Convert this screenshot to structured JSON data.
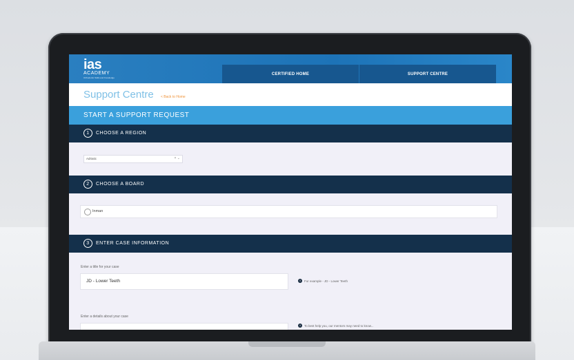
{
  "header": {
    "logo_mark": "ias",
    "logo_sub": "ACADEMY",
    "logo_tag": "Orthodontic Skills and Knowledge"
  },
  "nav": {
    "items": [
      "CERTIFIED HOME",
      "SUPPORT CENTRE"
    ]
  },
  "page": {
    "title": "Support Centre",
    "back_link": "< Back to Home"
  },
  "start_bar": {
    "label": "START A SUPPORT REQUEST"
  },
  "sections": [
    {
      "number": "1",
      "label": "CHOOSE A REGION"
    },
    {
      "number": "2",
      "label": "CHOOSE A BOARD"
    },
    {
      "number": "3",
      "label": "ENTER CASE INFORMATION"
    }
  ],
  "region": {
    "selected": "Adriatic",
    "clear": "×",
    "chevron": "⌄"
  },
  "board": {
    "option_label": "Inman"
  },
  "case": {
    "title_label": "Enter a title for your case",
    "title_value": "JD - Lower Teeth",
    "title_hint": "For example - JD - Lower Teeth",
    "details_label": "Enter a details about your case",
    "details_hint": "To best help you, our mentors may need to know..."
  },
  "icons": {
    "info": "info-icon",
    "radio": "radio-icon"
  },
  "colors": {
    "topbar": "#1d73b7",
    "nav": "#17578f",
    "start_bar": "#3aa0dc",
    "section_bar": "#14304b",
    "accent_link": "#f0943b"
  }
}
